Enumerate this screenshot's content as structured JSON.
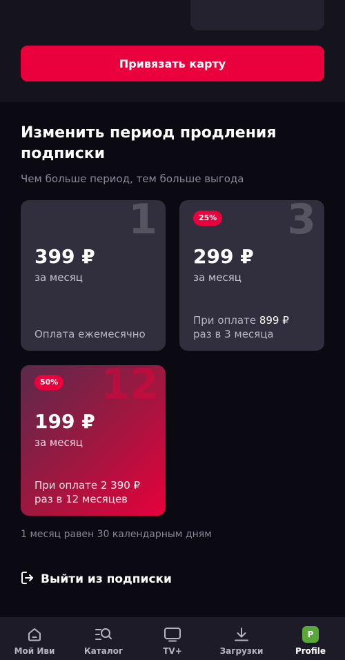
{
  "bind_card_button": "Привязать карту",
  "section": {
    "title": "Изменить период продления подписки",
    "subtitle": "Чем больше период, тем больше выгода"
  },
  "plans": [
    {
      "period_number": "1",
      "price": "399 ₽",
      "per_month": "за месяц",
      "note": "Оплата ежемесячно"
    },
    {
      "period_number": "3",
      "badge": "25%",
      "price": "299 ₽",
      "per_month": "за месяц",
      "note_prefix": "При оплате",
      "note_amount": "899 ₽",
      "note_suffix": "раз в 3 месяца"
    },
    {
      "period_number": "12",
      "badge": "50%",
      "price": "199 ₽",
      "per_month": "за месяц",
      "note_prefix": "При оплате",
      "note_amount": "2 390 ₽",
      "note_suffix": "раз в 12 месяцев"
    }
  ],
  "month_note": "1 месяц равен 30 календарным дням",
  "unsubscribe_label": "Выйти из подписки",
  "tabbar": [
    {
      "label": "Мой Иви",
      "icon": "home-icon"
    },
    {
      "label": "Каталог",
      "icon": "catalog-search-icon"
    },
    {
      "label": "TV+",
      "icon": "tv-icon"
    },
    {
      "label": "Загрузки",
      "icon": "download-icon"
    },
    {
      "label": "Profile",
      "icon": "profile-avatar",
      "avatar_letter": "P",
      "active": true
    }
  ],
  "colors": {
    "accent": "#ea003d",
    "background": "#0b0a12",
    "card": "#312f3e",
    "tabbar": "#1d1b27",
    "avatar": "#5aa83a"
  }
}
